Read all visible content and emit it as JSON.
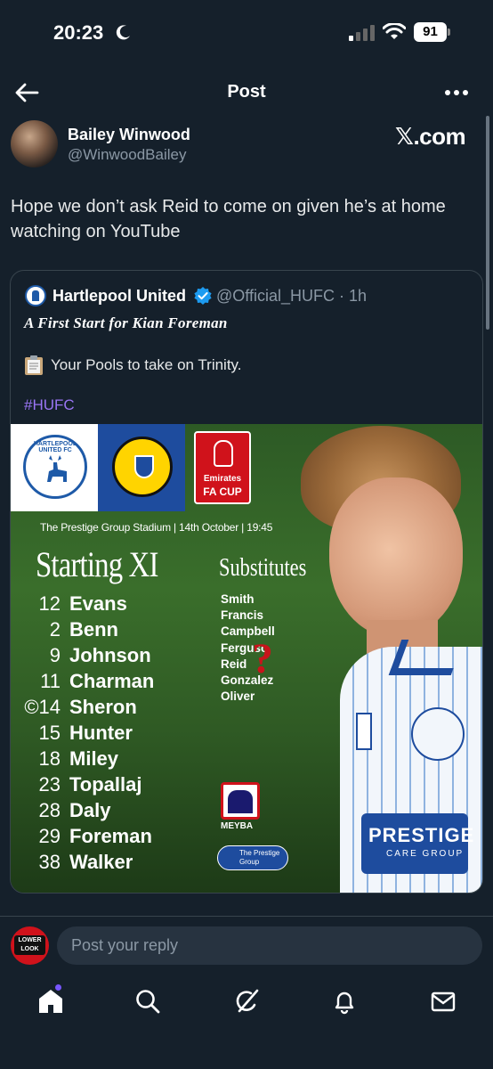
{
  "status_bar": {
    "time": "20:23",
    "battery": "91"
  },
  "header": {
    "title": "Post"
  },
  "tweet": {
    "author_name": "Bailey Winwood",
    "author_handle": "@WinwoodBailey",
    "watermark": "𝕏.com",
    "text": "Hope we don’t ask Reid to come on given he’s at home watching on YouTube"
  },
  "quote": {
    "author_name": "Hartlepool United",
    "author_handle": "@Official_HUFC · 1h",
    "line1": "A First Start for Kian Foreman",
    "line2": "Your Pools to take on Trinity.",
    "hashtag": "#HUFC"
  },
  "graphic": {
    "crest_hufc_text": "HARTLEPOOL UNITED FC",
    "facup_line1": "Emirates",
    "facup_line2": "FA CUP",
    "stadium_line": "The Prestige Group Stadium | 14th October | 19:45",
    "xi_title": "Starting XI",
    "subs_title": "Substitutes",
    "starting_xi": [
      {
        "num": "12",
        "name": "Evans"
      },
      {
        "num": "2",
        "name": "Benn"
      },
      {
        "num": "9",
        "name": "Johnson"
      },
      {
        "num": "11",
        "name": "Charman"
      },
      {
        "num": "©14",
        "name": "Sheron"
      },
      {
        "num": "15",
        "name": "Hunter"
      },
      {
        "num": "18",
        "name": "Miley"
      },
      {
        "num": "23",
        "name": "Topallaj"
      },
      {
        "num": "28",
        "name": "Daly"
      },
      {
        "num": "29",
        "name": "Foreman"
      },
      {
        "num": "38",
        "name": "Walker"
      }
    ],
    "substitutes": [
      "Smith",
      "Francis",
      "Campbell",
      "Ferguso",
      "Reid",
      "Gonzalez",
      "Oliver"
    ],
    "question_mark": "?",
    "meyba_label": "MEYBA",
    "prestige_badge": "The Prestige Group",
    "sponsor_line1": "PRESTIGE",
    "sponsor_line2": "CARE GROUP"
  },
  "reply": {
    "avatar_text": "LOWER LOOK",
    "placeholder": "Post your reply"
  },
  "colors": {
    "background": "#15202b",
    "border": "#38444d",
    "accent_purple": "#9a75f5",
    "verified": "#1d9bf0"
  },
  "icons": [
    "back-arrow-icon",
    "more-icon",
    "verified-icon",
    "clipboard-icon",
    "home-icon",
    "search-icon",
    "grok-icon",
    "bell-icon",
    "mail-icon"
  ]
}
